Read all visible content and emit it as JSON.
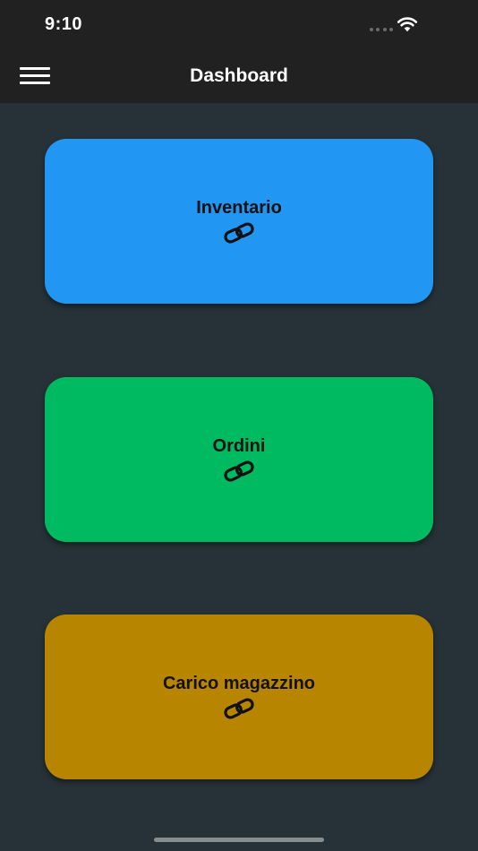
{
  "status_bar": {
    "time": "9:10",
    "wifi_icon": "wifi-icon",
    "signal_icon": "cellular-signal-icon"
  },
  "app_bar": {
    "menu_icon": "hamburger-menu-icon",
    "title": "Dashboard",
    "background": "#212121"
  },
  "theme": {
    "page_background": "#263238",
    "text_color": "#111111"
  },
  "cards": [
    {
      "label": "Inventario",
      "icon": "link-icon",
      "color": "#2196F3"
    },
    {
      "label": "Ordini",
      "icon": "link-icon",
      "color": "#00BA62"
    },
    {
      "label": "Carico magazzino",
      "icon": "link-icon",
      "color": "#B88500"
    }
  ]
}
